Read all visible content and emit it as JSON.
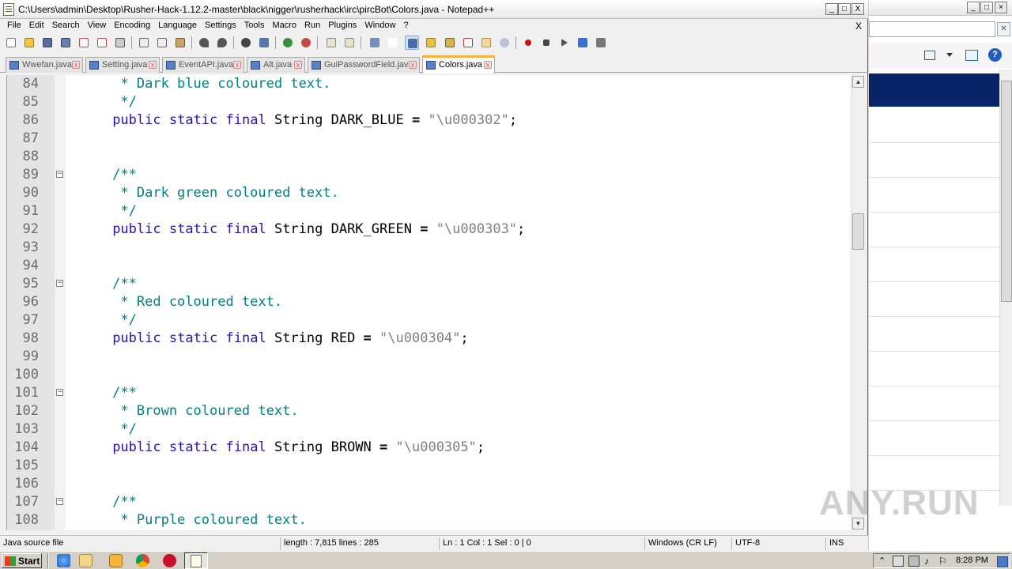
{
  "window": {
    "title": "C:\\Users\\admin\\Desktop\\Rusher-Hack-1.12.2-master\\black\\nigger\\rusherhack\\irc\\pircBot\\Colors.java - Notepad++",
    "min": "_",
    "max": "□",
    "close": "X"
  },
  "menu": {
    "items": [
      "File",
      "Edit",
      "Search",
      "View",
      "Encoding",
      "Language",
      "Settings",
      "Tools",
      "Macro",
      "Run",
      "Plugins",
      "Window",
      "?"
    ],
    "close": "X"
  },
  "tabs": [
    {
      "label": "Wwefan.java",
      "active": false
    },
    {
      "label": "Setting.java",
      "active": false
    },
    {
      "label": "EventAPI.java",
      "active": false
    },
    {
      "label": "Alt.java",
      "active": false
    },
    {
      "label": "GuiPasswordField.java",
      "active": false
    },
    {
      "label": "Colors.java",
      "active": true
    }
  ],
  "tab_close": "x",
  "editor": {
    "lines": [
      {
        "n": "84",
        "fold": "",
        "text": "      * Dark blue coloured text.",
        "kind": "comment"
      },
      {
        "n": "85",
        "fold": "",
        "text": "      */",
        "kind": "comment"
      },
      {
        "n": "86",
        "fold": "",
        "text": "     public static final String DARK_BLUE = \"\\u000302\";",
        "kind": "decl"
      },
      {
        "n": "87",
        "fold": "",
        "text": "",
        "kind": "blank"
      },
      {
        "n": "88",
        "fold": "",
        "text": "",
        "kind": "blank"
      },
      {
        "n": "89",
        "fold": "⊟",
        "text": "     /**",
        "kind": "comment"
      },
      {
        "n": "90",
        "fold": "",
        "text": "      * Dark green coloured text.",
        "kind": "comment"
      },
      {
        "n": "91",
        "fold": "",
        "text": "      */",
        "kind": "comment"
      },
      {
        "n": "92",
        "fold": "",
        "text": "     public static final String DARK_GREEN = \"\\u000303\";",
        "kind": "decl"
      },
      {
        "n": "93",
        "fold": "",
        "text": "",
        "kind": "blank"
      },
      {
        "n": "94",
        "fold": "",
        "text": "",
        "kind": "blank"
      },
      {
        "n": "95",
        "fold": "⊟",
        "text": "     /**",
        "kind": "comment"
      },
      {
        "n": "96",
        "fold": "",
        "text": "      * Red coloured text.",
        "kind": "comment"
      },
      {
        "n": "97",
        "fold": "",
        "text": "      */",
        "kind": "comment"
      },
      {
        "n": "98",
        "fold": "",
        "text": "     public static final String RED = \"\\u000304\";",
        "kind": "decl"
      },
      {
        "n": "99",
        "fold": "",
        "text": "",
        "kind": "blank"
      },
      {
        "n": "100",
        "fold": "",
        "text": "",
        "kind": "blank"
      },
      {
        "n": "101",
        "fold": "⊟",
        "text": "     /**",
        "kind": "comment"
      },
      {
        "n": "102",
        "fold": "",
        "text": "      * Brown coloured text.",
        "kind": "comment"
      },
      {
        "n": "103",
        "fold": "",
        "text": "      */",
        "kind": "comment"
      },
      {
        "n": "104",
        "fold": "",
        "text": "     public static final String BROWN = \"\\u000305\";",
        "kind": "decl"
      },
      {
        "n": "105",
        "fold": "",
        "text": "",
        "kind": "blank"
      },
      {
        "n": "106",
        "fold": "",
        "text": "",
        "kind": "blank"
      },
      {
        "n": "107",
        "fold": "⊟",
        "text": "     /**",
        "kind": "comment"
      },
      {
        "n": "108",
        "fold": "",
        "text": "      * Purple coloured text.",
        "kind": "comment"
      }
    ],
    "colors": {
      "keyword": "#2d12aa",
      "comment": "#008080",
      "string": "#808080",
      "linenumber": "#6d6d6d"
    }
  },
  "status": {
    "filetype": "Java source file",
    "length": "length : 7,815    lines : 285",
    "position": "Ln : 1    Col : 1    Sel : 0 | 0",
    "eol": "Windows (CR LF)",
    "encoding": "UTF-8",
    "mode": "INS"
  },
  "taskbar": {
    "start": "Start",
    "clock": "8:28 PM"
  },
  "watermark": "ANY.RUN"
}
